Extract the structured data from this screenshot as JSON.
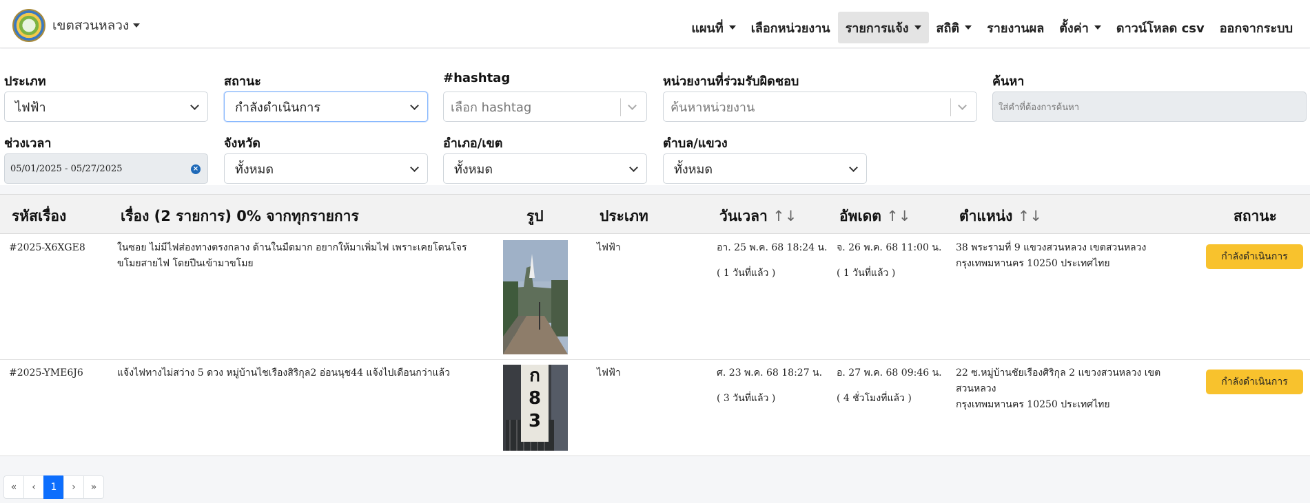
{
  "brand": {
    "name": "เขตสวนหลวง",
    "logo_icon": "district-seal-logo"
  },
  "nav": {
    "items": [
      {
        "label": "แผนที่",
        "dropdown": true
      },
      {
        "label": "เลือกหน่วยงาน",
        "dropdown": false
      },
      {
        "label": "รายการแจ้ง",
        "dropdown": true,
        "active": true
      },
      {
        "label": "สถิติ",
        "dropdown": true
      },
      {
        "label": "รายงานผล",
        "dropdown": false
      },
      {
        "label": "ตั้งค่า",
        "dropdown": true
      },
      {
        "label": "ดาวน์โหลด csv",
        "dropdown": false
      },
      {
        "label": "ออกจากระบบ",
        "dropdown": false
      }
    ]
  },
  "filters": {
    "type": {
      "label": "ประเภท",
      "value": "ไฟฟ้า"
    },
    "status": {
      "label": "สถานะ",
      "value": "กำลังดำเนินการ"
    },
    "hashtag": {
      "label": "#hashtag",
      "placeholder": "เลือก hashtag"
    },
    "agency": {
      "label": "หน่วยงานที่ร่วมรับผิดชอบ",
      "placeholder": "ค้นหาหน่วยงาน"
    },
    "search": {
      "label": "ค้นหา",
      "placeholder": "ใส่คำที่ต้องการค้นหา"
    },
    "period": {
      "label": "ช่วงเวลา",
      "value": "05/01/2025 - 05/27/2025"
    },
    "province": {
      "label": "จังหวัด",
      "value": "ทั้งหมด"
    },
    "district": {
      "label": "อำเภอ/เขต",
      "value": "ทั้งหมด"
    },
    "subdistrict": {
      "label": "ตำบล/แขวง",
      "value": "ทั้งหมด"
    }
  },
  "table": {
    "headers": {
      "id": "รหัสเรื่อง",
      "title": "เรื่อง (2 รายการ) 0% จากทุกรายการ",
      "image": "รูป",
      "type": "ประเภท",
      "datetime": "วันเวลา",
      "updated": "อัพเดต",
      "location": "ตำแหน่ง",
      "status": "สถานะ"
    },
    "sort_glyph": "↑↓",
    "rows": [
      {
        "id": "#2025-X6XGE8",
        "description_line1": "ในซอย ไม่มีไฟส่องทางตรงกลาง ด้านในมืดมาก อยากให้มาเพิ่มไฟ เพราะเคยโดนโจร",
        "description_line2": "ขโมยสายไฟ โดยปีนเข้ามาขโมย",
        "type": "ไฟฟ้า",
        "datetime": "อา. 25 พ.ค. 68 18:24 น.",
        "datetime_ago": "( 1 วันที่แล้ว )",
        "updated": "จ. 26 พ.ค. 68 11:00 น.",
        "updated_ago": "( 1 วันที่แล้ว )",
        "location_line1": "38 พระรามที่ 9 แขวงสวนหลวง เขตสวนหลวง",
        "location_line2": "กรุงเทพมหานคร 10250 ประเทศไทย",
        "status": "กำลังดำเนินการ"
      },
      {
        "id": "#2025-YME6J6",
        "description_line1": "แจ้งไฟทางไม่สว่าง 5 ดวง หมู่บ้านไชเรืองสิริกุล2 อ่อนนุช44 แจ้งไปเดือนกว่าแล้ว",
        "description_line2": "",
        "type": "ไฟฟ้า",
        "datetime": "ศ. 23 พ.ค. 68 18:27 น.",
        "datetime_ago": "( 3 วันที่แล้ว )",
        "updated": "อ. 27 พ.ค. 68 09:46 น.",
        "updated_ago": "( 4 ชั่วโมงที่แล้ว )",
        "location_line1": "22 ซ.หมู่บ้านชัยเรืองศิริกุล 2 แขวงสวนหลวง เขตสวนหลวง",
        "location_line2": "กรุงเทพมหานคร 10250 ประเทศไทย",
        "status": "กำลังดำเนินการ",
        "photo_text": [
          "ก",
          "8",
          "3"
        ]
      }
    ]
  },
  "pagination": {
    "first": "«",
    "prev": "‹",
    "current": "1",
    "next": "›",
    "last": "»"
  },
  "colors": {
    "status_badge": "#f8c22d",
    "active_page": "#0d6efd",
    "nav_active_bg": "#e4e4e4"
  }
}
